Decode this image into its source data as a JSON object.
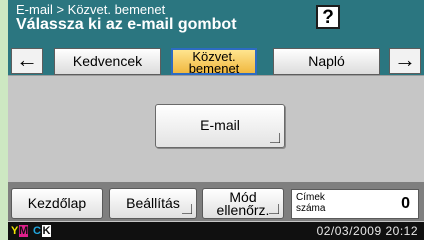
{
  "header": {
    "breadcrumb": "E-mail > Közvet. bemenet",
    "title": "Válassza ki az e-mail gombot",
    "help_label": "?"
  },
  "tabs": {
    "prev_arrow": "←",
    "next_arrow": "→",
    "items": [
      {
        "label": "Kedvencek"
      },
      {
        "label_line1": "Közvet.",
        "label_line2": "bemenet"
      },
      {
        "label": "Napló"
      }
    ]
  },
  "main": {
    "email_button_label": "E-mail"
  },
  "bottom": {
    "home_label": "Kezdőlap",
    "settings_label": "Beállítás",
    "mode_line1": "Mód",
    "mode_line2": "ellenőrz.",
    "address_count_label_line1": "Címek",
    "address_count_label_line2": "száma",
    "address_count_value": "0"
  },
  "status": {
    "toner": [
      {
        "letter": "Y",
        "color": "#f2e600"
      },
      {
        "letter": "M",
        "color": "#e0208c"
      },
      {
        "letter": "C",
        "color": "#22a8e0"
      },
      {
        "letter": "K",
        "color": "#ffffff"
      }
    ],
    "datetime": "02/03/2009  20:12"
  },
  "colors": {
    "header_bg": "#2b7680",
    "active_tab": "#f0b840",
    "background": "#c6c6c6"
  }
}
